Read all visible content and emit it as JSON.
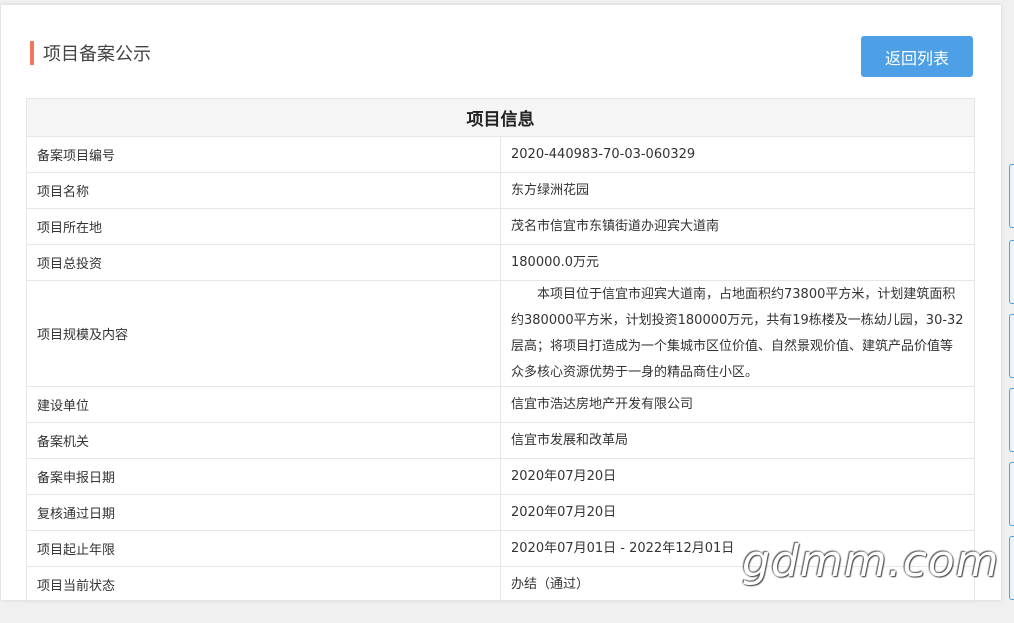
{
  "page": {
    "title": "项目备案公示",
    "back_button": "返回列表"
  },
  "table": {
    "header": "项目信息",
    "rows": [
      {
        "label": "备案项目编号",
        "value": "2020-440983-70-03-060329"
      },
      {
        "label": "项目名称",
        "value": "东方绿洲花园"
      },
      {
        "label": "项目所在地",
        "value": "茂名市信宜市东镇街道办迎宾大道南"
      },
      {
        "label": "项目总投资",
        "value": "180000.0万元"
      },
      {
        "label": "项目规模及内容",
        "value": "本项目位于信宜市迎宾大道南，占地面积约73800平方米，计划建筑面积约380000平方米，计划投资180000万元，共有19栋楼及一栋幼儿园，30-32层高；将项目打造成为一个集城市区位价值、自然景观价值、建筑产品价值等众多核心资源优势于一身的精品商住小区。"
      },
      {
        "label": "建设单位",
        "value": "信宜市浩达房地产开发有限公司"
      },
      {
        "label": "备案机关",
        "value": "信宜市发展和改革局"
      },
      {
        "label": "备案申报日期",
        "value": "2020年07月20日"
      },
      {
        "label": "复核通过日期",
        "value": "2020年07月20日"
      },
      {
        "label": "项目起止年限",
        "value": "2020年07月01日 - 2022年12月01日"
      },
      {
        "label": "项目当前状态",
        "value": "办结（通过）"
      }
    ]
  },
  "watermark": "gdmm.com",
  "colors": {
    "accent": "#f0775c",
    "button": "#4da0e6",
    "border": "#e6e6e6",
    "header_bg": "#f5f5f5"
  }
}
